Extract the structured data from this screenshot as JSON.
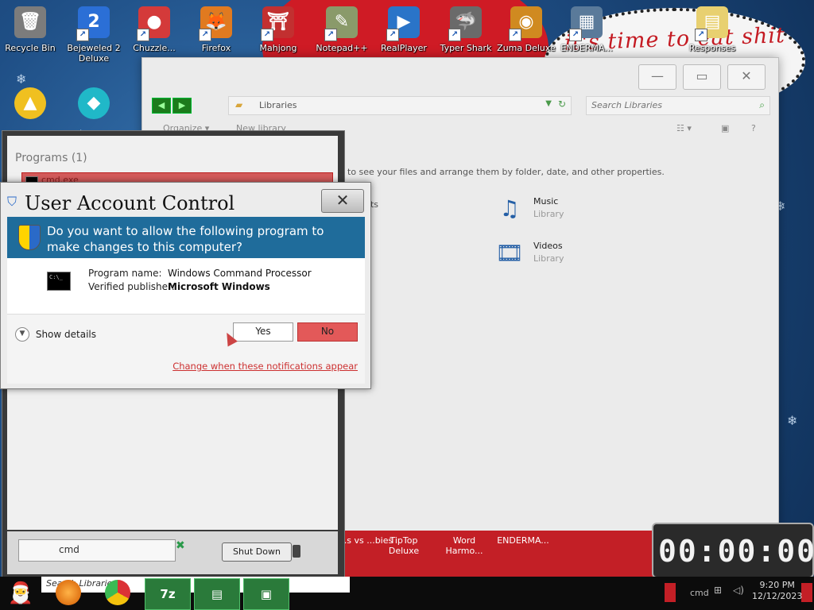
{
  "desktop": {
    "speech_text": "it's time to eat shit",
    "icons": [
      {
        "label": "Recycle Bin",
        "glyph": "🗑"
      },
      {
        "label": "Bejeweled 2 Deluxe",
        "glyph": "2"
      },
      {
        "label": "Chuzzle...",
        "glyph": "●"
      },
      {
        "label": "Firefox",
        "glyph": "🦊"
      },
      {
        "label": "Mahjong",
        "glyph": "⛩"
      },
      {
        "label": "Notepad++",
        "glyph": "✎"
      },
      {
        "label": "RealPlayer",
        "glyph": "▶"
      },
      {
        "label": "Typer Shark",
        "glyph": "🦈"
      },
      {
        "label": "Zuma Deluxe",
        "glyph": "◉"
      },
      {
        "label": "ENDERMA...",
        "glyph": "▦"
      },
      {
        "label": "Responses",
        "glyph": "▤"
      }
    ],
    "row2_icons": [
      {
        "label": "",
        "glyph": "▲"
      },
      {
        "label": "",
        "glyph": "◆"
      }
    ]
  },
  "explorer": {
    "address": "Libraries",
    "search_placeholder": "Search Libraries",
    "toolbar": {
      "organize": "Organize ▾",
      "new_library": "New library"
    },
    "description": "y to see your files and arrange them by folder, date, and other properties.",
    "libraries": [
      {
        "name": "Music",
        "type": "Library",
        "glyph": "♫"
      },
      {
        "name": "Videos",
        "type": "Library",
        "glyph": "🎞"
      }
    ],
    "partial_label": "nts"
  },
  "startmenu": {
    "heading": "Programs (1)",
    "result": "cmd.exe",
    "search_value": "cmd",
    "shutdown_label": "Shut Down"
  },
  "uac": {
    "title": "User Account Control",
    "question": "Do you want to allow the following program to make changes to this computer?",
    "program_name_label": "Program name:",
    "program_name": "Windows Command Processor",
    "publisher_label": "Verified publisher:",
    "publisher": "Microsoft Windows",
    "show_details": "Show details",
    "yes": "Yes",
    "no": "No",
    "change_link": "Change when these notifications appear"
  },
  "taskbar": {
    "search_text": "Search Libraries",
    "pins": [
      {
        "label": "...s vs ...bies"
      },
      {
        "label": "TipTop Deluxe"
      },
      {
        "label": "Word Harmo..."
      },
      {
        "label": "ENDERMA..."
      }
    ],
    "app_7z": "7z",
    "clock_time": "9:20 PM",
    "clock_date": "12/12/2023",
    "tray_text": "cmd"
  },
  "timer": {
    "value": "00:00:00"
  },
  "colors": {
    "accent_red": "#cf1b25",
    "uac_banner": "#1f6c9b",
    "no_button": "#e35959"
  }
}
